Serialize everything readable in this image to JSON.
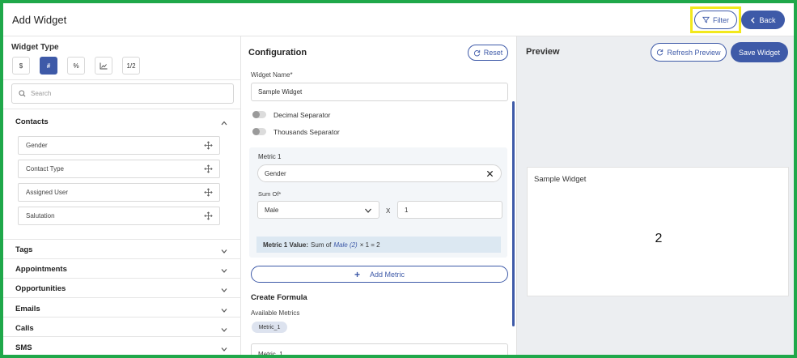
{
  "header": {
    "title": "Add Widget",
    "filter_label": "Filter",
    "back_label": "Back"
  },
  "widget_type": {
    "title": "Widget Type",
    "types": [
      "$",
      "#",
      "%",
      "chart",
      "1/2"
    ],
    "selected": "#"
  },
  "search": {
    "placeholder": "Search"
  },
  "groups": {
    "contacts": {
      "label": "Contacts",
      "expanded": true,
      "fields": [
        "Gender",
        "Contact Type",
        "Assigned User",
        "Salutation"
      ]
    },
    "collapsed": [
      "Tags",
      "Appointments",
      "Opportunities",
      "Emails",
      "Calls",
      "SMS"
    ]
  },
  "config": {
    "title": "Configuration",
    "reset_label": "Reset",
    "widget_name_label": "Widget Name*",
    "widget_name_value": "Sample Widget",
    "decimal_separator_label": "Decimal Separator",
    "thousands_separator_label": "Thousands Separator",
    "metric": {
      "title": "Metric 1",
      "field": "Gender",
      "sum_of_label": "Sum Of*",
      "sum_of_value": "Male",
      "multiplier_x": "X",
      "multiplier_value": "1",
      "value_label": "Metric 1 Value:",
      "value_prefix": "Sum of",
      "value_term": "Male (2)",
      "value_suffix": "× 1 = 2"
    },
    "add_metric_label": "Add Metric",
    "create_formula_title": "Create Formula",
    "available_metrics_label": "Available Metrics",
    "available_metric_chip": "Metric_1",
    "formula_value": "Metric_1"
  },
  "preview": {
    "title": "Preview",
    "refresh_label": "Refresh Preview",
    "save_label": "Save Widget",
    "card_title": "Sample Widget",
    "card_value": "2"
  },
  "colors": {
    "accent": "#3e5aa8",
    "frame": "#1fa84a",
    "highlight": "#f2e81c"
  }
}
